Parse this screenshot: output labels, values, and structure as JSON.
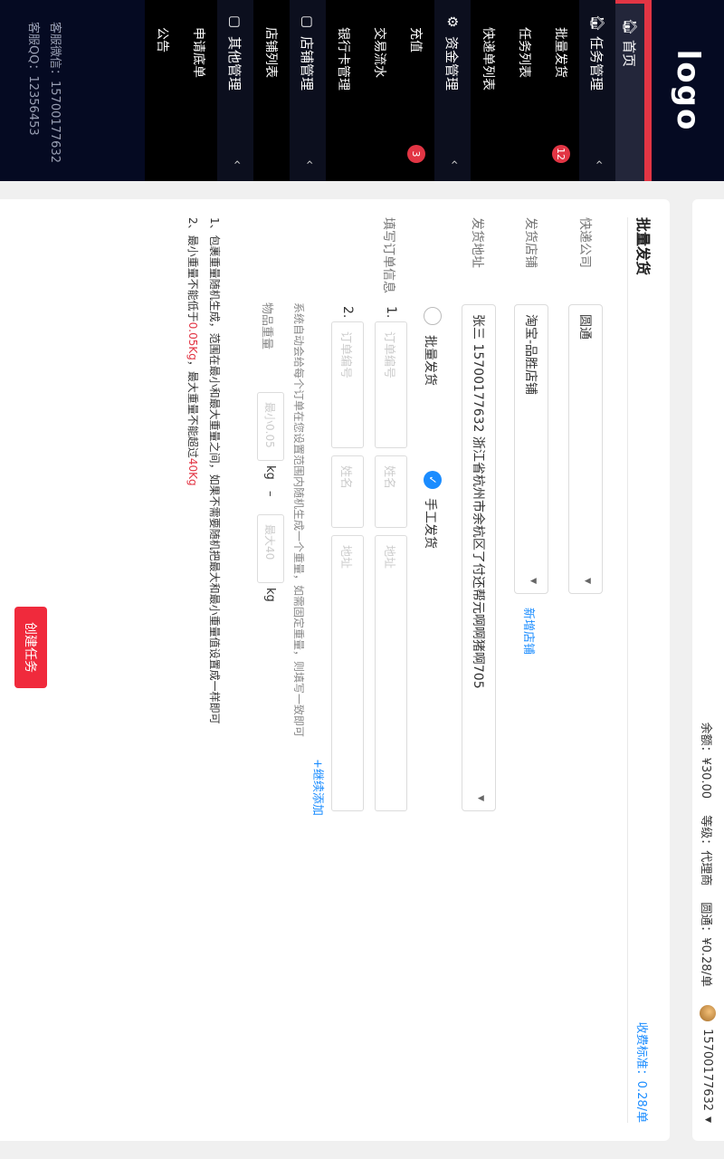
{
  "sidebar": {
    "logo": "logo",
    "home": "首页",
    "task_mgmt": "任务管理",
    "task_items": [
      {
        "label": "批量发货",
        "badge": "12"
      },
      {
        "label": "任务列表"
      },
      {
        "label": "快递单列表"
      }
    ],
    "fund_mgmt": "资金管理",
    "fund_items": [
      {
        "label": "充值",
        "badge": "3"
      },
      {
        "label": "交易流水"
      },
      {
        "label": "银行卡管理"
      }
    ],
    "shop_mgmt": "店铺管理",
    "shop_items": [
      {
        "label": "店铺列表"
      }
    ],
    "other_mgmt": "其他管理",
    "other_items": [
      {
        "label": "申请底单"
      },
      {
        "label": "公告"
      }
    ],
    "contact_wechat": "客服微信：15700177632",
    "contact_qq": "客服QQ：12356453"
  },
  "topbar": {
    "balance": "余额：¥30.00",
    "level": "等级：代理商",
    "rate": "圆通：¥0.28/单",
    "user": "15700177632"
  },
  "form": {
    "title": "批量发货",
    "pricing": "收费标准：0.28/单",
    "courier_label": "快递公司",
    "courier_value": "圆通",
    "shop_label": "发货店铺",
    "shop_value": "淘宝-品胜店铺",
    "add_shop": "新增店铺",
    "address_label": "发货地址",
    "address_value": "张三  15700177632  浙江省杭州市余杭区了付还帮元啊啊猪啊705",
    "mode_batch": "批量发货",
    "mode_manual": "手工发货",
    "order_label": "填写订单信息",
    "rows": [
      "1.",
      "2."
    ],
    "ph_order": "订单编号",
    "ph_name": "姓名",
    "ph_address": "地址",
    "add_more": "+继续添加",
    "auto_note": "系统自动会给每个订单在您设置范围内随机生成一个重量，如需固定重量，则填写一致即可",
    "weight_label": "物品重量",
    "ph_min": "最小0.05",
    "ph_max": "最大40",
    "unit": "kg",
    "dash": "–",
    "note1_prefix": "1、包裹重量随机生成，范围在最小和最大重量之间，如果不需要随机把最大和最小重量值设置成一样即可",
    "note2_a": "2、最小重量不能低于",
    "note2_b": "0.05Kg",
    "note2_c": "，最大重量不能超过",
    "note2_d": "40Kg",
    "submit": "创建任务"
  }
}
